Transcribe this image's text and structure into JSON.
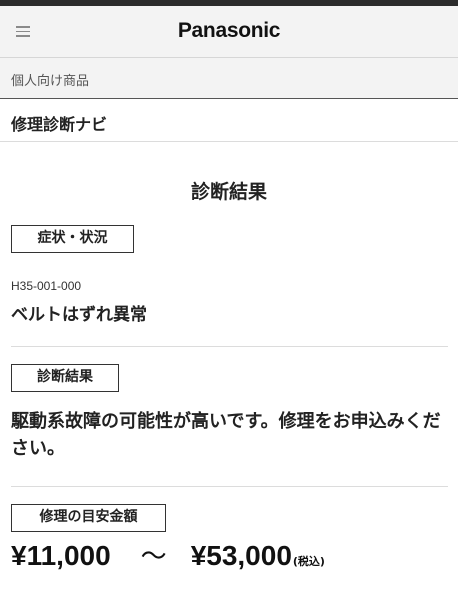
{
  "header": {
    "brand": "Panasonic"
  },
  "subnav": {
    "category": "個人向け商品"
  },
  "page": {
    "title": "修理診断ナビ",
    "section_heading": "診断結果"
  },
  "symptom": {
    "label": "症状・状況",
    "code": "H35-001-000",
    "description": "ベルトはずれ異常"
  },
  "diagnosis": {
    "label": "診断結果",
    "text": "駆動系故障の可能性が高いです。修理をお申込みください。"
  },
  "estimate": {
    "label": "修理の目安金額",
    "min_price": "¥11,000",
    "separator": "〜",
    "max_price": "¥53,000",
    "tax_note": "(税込)"
  }
}
